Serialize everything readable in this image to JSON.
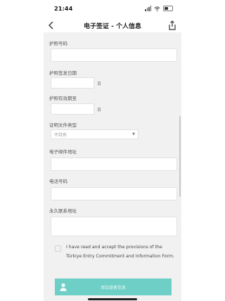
{
  "status_bar": {
    "time": "21:44"
  },
  "nav": {
    "title": "电子签证 - 个人信息"
  },
  "form": {
    "passport_number_label": "护照号码",
    "passport_issue_date_label": "护照签发日期",
    "passport_expiry_label": "护照有效期至",
    "document_type_label": "证明文件类型",
    "document_type_value": "不持有",
    "email_label": "电子邮件地址",
    "phone_label": "电话号码",
    "address_label": "永久联系地址",
    "calendar_icon_text": "日"
  },
  "consent": {
    "text": "I have read and accept the provisions of the Türkiye Entry Commitment and Information Form."
  },
  "submit": {
    "label": "添加旅客信息"
  },
  "colors": {
    "accent": "#6ecfc6",
    "panel_bg": "#f1f1f1"
  }
}
